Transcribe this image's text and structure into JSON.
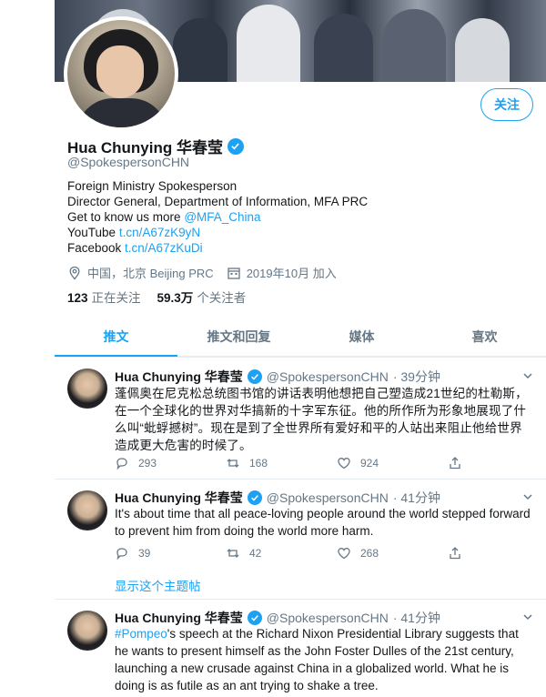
{
  "profile": {
    "follow_label": "关注",
    "name": "Hua Chunying 华春莹",
    "handle": "@SpokespersonCHN",
    "bio": {
      "line1": "Foreign Ministry Spokesperson",
      "line2": "Director General, Department of Information, MFA PRC",
      "line3_prefix": "Get to know us more ",
      "line3_link": "@MFA_China",
      "line4_prefix": "YouTube ",
      "line4_link": "t.cn/A67zK9yN",
      "line5_prefix": "Facebook ",
      "line5_link": "t.cn/A67zKuDi"
    },
    "location": "中国，北京 Beijing PRC",
    "joined": "2019年10月 加入",
    "following_count": "123",
    "following_label": "正在关注",
    "followers_count": "59.3万",
    "followers_label": "个关注者"
  },
  "tabs": [
    "推文",
    "推文和回复",
    "媒体",
    "喜欢"
  ],
  "tweets": [
    {
      "name": "Hua Chunying 华春莹",
      "handle": "@SpokespersonCHN",
      "time": "· 39分钟",
      "text": "蓬佩奥在尼克松总统图书馆的讲话表明他想把自己塑造成21世纪的杜勒斯，在一个全球化的世界对华搞新的十字军东征。他的所作所为形象地展现了什么叫“蚍蜉撼树”。现在是到了全世界所有爱好和平的人站出来阻止他给世界造成更大危害的时候了。",
      "replies": "293",
      "retweets": "168",
      "likes": "924"
    },
    {
      "name": "Hua Chunying 华春莹",
      "handle": "@SpokespersonCHN",
      "time": "· 41分钟",
      "text": "It's about time that all peace-loving people around the world stepped forward to prevent him from doing the world more harm.",
      "replies": "39",
      "retweets": "42",
      "likes": "268",
      "thread_label": "显示这个主题帖"
    },
    {
      "name": "Hua Chunying 华春莹",
      "handle": "@SpokespersonCHN",
      "time": "· 41分钟",
      "hashtag": "#Pompeo",
      "text": "'s speech at the Richard Nixon Presidential Library suggests that he wants to present himself as the John Foster Dulles of the 21st century, launching a new crusade against China in a globalized world. What he is doing is as futile as an ant trying to shake a tree."
    }
  ],
  "colors": {
    "accent": "#1da1f2",
    "secondary_text": "#657786",
    "border": "#e6ecf0"
  }
}
